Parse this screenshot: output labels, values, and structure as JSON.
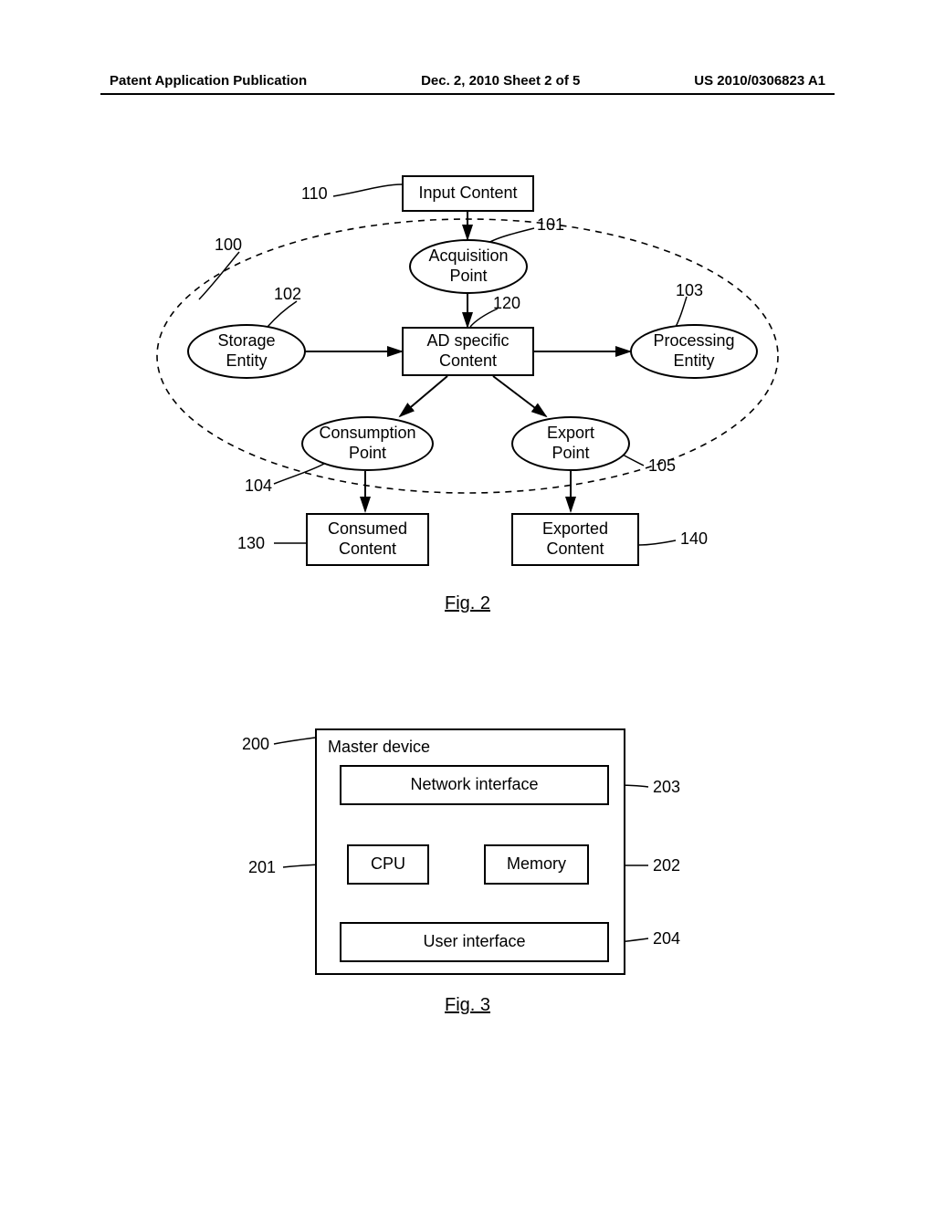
{
  "header": {
    "left": "Patent Application Publication",
    "center": "Dec. 2, 2010   Sheet 2 of 5",
    "right": "US 2010/0306823 A1"
  },
  "fig2": {
    "caption": "Fig. 2",
    "nodes": {
      "input_content": "Input Content",
      "acquisition_point": "Acquisition\nPoint",
      "storage_entity": "Storage\nEntity",
      "ad_specific": "AD specific\nContent",
      "processing_entity": "Processing\nEntity",
      "consumption_point": "Consumption\nPoint",
      "export_point": "Export\nPoint",
      "consumed_content": "Consumed\nContent",
      "exported_content": "Exported\nContent"
    },
    "labels": {
      "n100": "100",
      "n101": "101",
      "n102": "102",
      "n103": "103",
      "n104": "104",
      "n105": "105",
      "n110": "110",
      "n120": "120",
      "n130": "130",
      "n140": "140"
    }
  },
  "fig3": {
    "caption": "Fig. 3",
    "nodes": {
      "master_device": "Master device",
      "network_interface": "Network interface",
      "cpu": "CPU",
      "memory": "Memory",
      "user_interface": "User interface"
    },
    "labels": {
      "n200": "200",
      "n201": "201",
      "n202": "202",
      "n203": "203",
      "n204": "204"
    }
  }
}
